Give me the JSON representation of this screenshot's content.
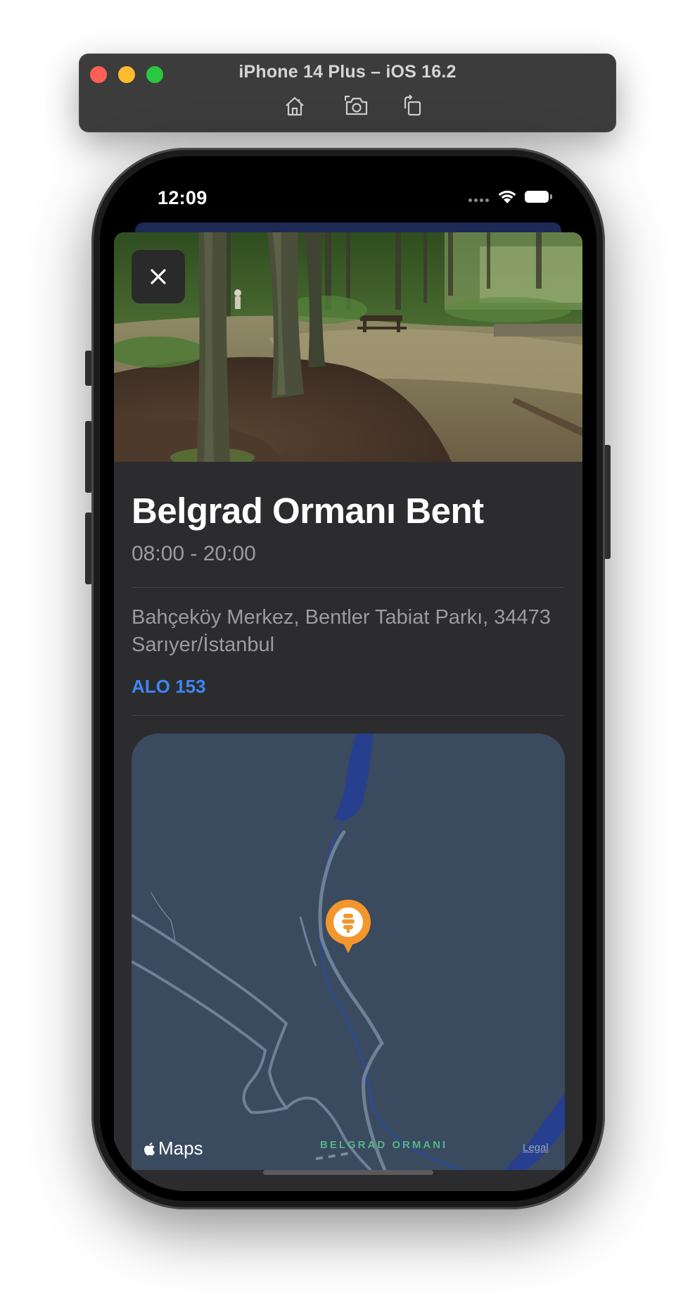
{
  "simulator": {
    "title": "iPhone 14 Plus – iOS 16.2",
    "tools": [
      "home-icon",
      "screenshot-icon",
      "rotate-icon"
    ]
  },
  "status_bar": {
    "time": "12:09",
    "icons": [
      "cellular-dots-icon",
      "wifi-icon",
      "battery-icon"
    ]
  },
  "place": {
    "title": "Belgrad Ormanı Bent",
    "hours": "08:00 - 20:00",
    "address": "Bahçeköy Merkez, Bentler Tabiat Parkı, 34473 Sarıyer/İstanbul",
    "phone": "ALO 153"
  },
  "map": {
    "logo": "Maps",
    "area_label": "BELGRAD ORMANI",
    "legal": "Legal",
    "pin_icon": "water-tap-icon"
  },
  "colors": {
    "sheet_background": "#2c2c2e",
    "link": "#3d86f5",
    "map_background": "#3a4a5f",
    "water": "#26408f",
    "pin": "#f3962c",
    "area_label": "#55b585"
  }
}
